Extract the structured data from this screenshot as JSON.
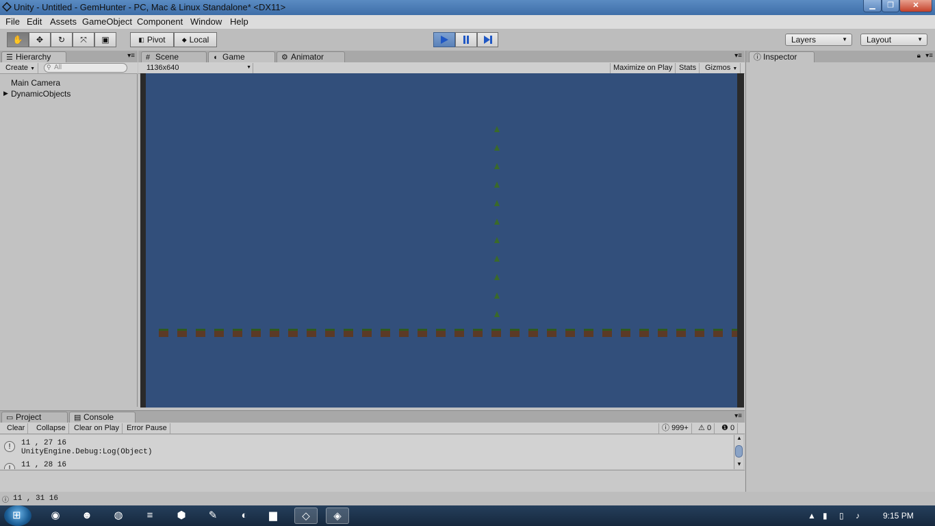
{
  "window": {
    "title": "Unity - Untitled - GemHunter - PC, Mac & Linux Standalone* <DX11>",
    "min": "▁",
    "max": "❐",
    "close": "✕"
  },
  "menu": [
    "File",
    "Edit",
    "Assets",
    "GameObject",
    "Component",
    "Window",
    "Help"
  ],
  "toolbar": {
    "pivot": "Pivot",
    "local": "Local",
    "layers": "Layers",
    "layout": "Layout"
  },
  "hierarchy": {
    "tab": "Hierarchy",
    "create": "Create",
    "search_placeholder": "All",
    "items": [
      "Main Camera",
      "DynamicObjects"
    ]
  },
  "center_tabs": [
    "Scene",
    "Game",
    "Animator"
  ],
  "game_bar": {
    "resolution": "1136x640",
    "maximize": "Maximize on Play",
    "stats": "Stats",
    "gizmos": "Gizmos"
  },
  "inspector": {
    "tab": "Inspector"
  },
  "bottom_tabs": [
    "Project",
    "Console"
  ],
  "console": {
    "buttons": [
      "Clear",
      "Collapse",
      "Clear on Play",
      "Error Pause"
    ],
    "log_count": "999+",
    "warn_count": "0",
    "error_count": "0",
    "lines": [
      {
        "text": "11 , 27  16",
        "sub": "UnityEngine.Debug:Log(Object)"
      },
      {
        "text": "11 , 28  16",
        "sub": ""
      }
    ]
  },
  "status": {
    "text": "11 , 31  16"
  },
  "taskbar": {
    "time": "9:15 PM"
  },
  "colors": {
    "game_bg": "#324f7b",
    "gem": "#3b6a2a",
    "tile": "#5b3a26"
  }
}
